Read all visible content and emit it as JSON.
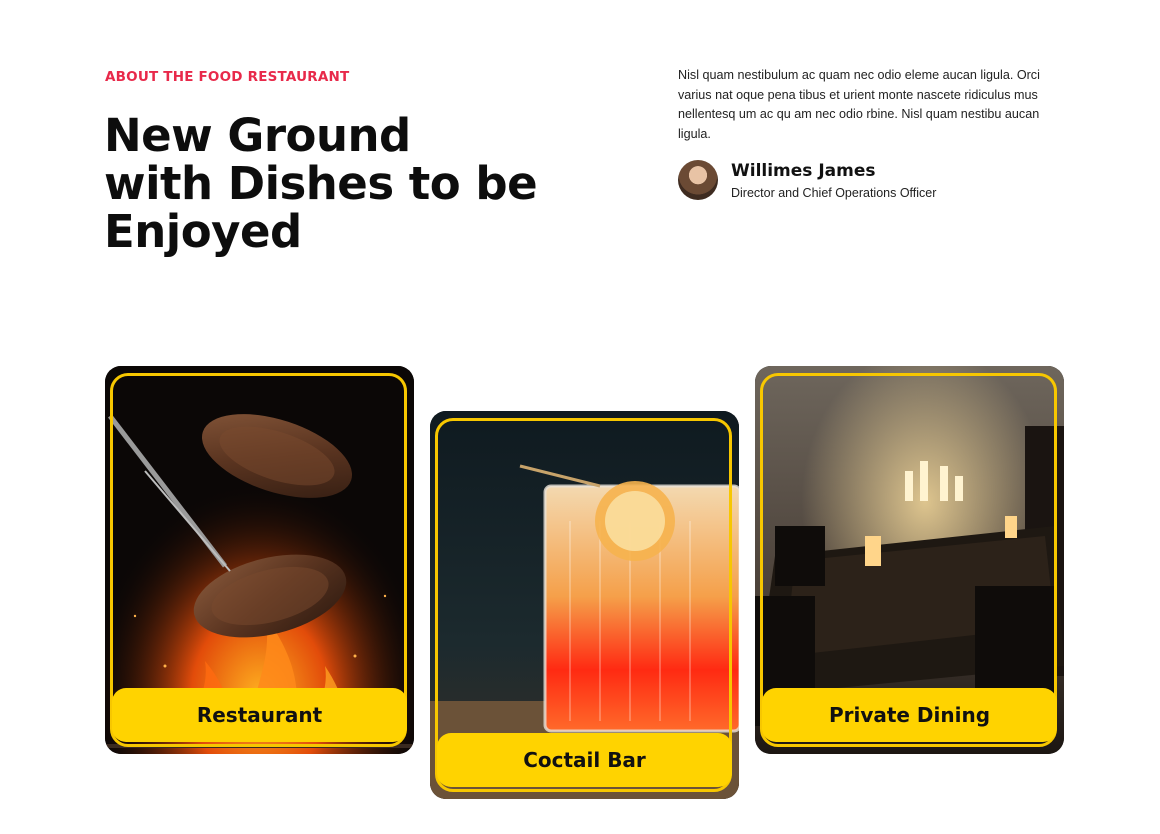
{
  "about": {
    "eyebrow": "ABOUT THE FOOD RESTAURANT",
    "headline_lines": [
      "New Ground",
      "with Dishes to be",
      "Enjoyed"
    ],
    "intro": "Nisl quam nestibulum ac quam nec odio eleme aucan ligula. Orci varius nat oque pena tibus et urient monte nascete ridiculus mus nellentesq um ac qu am nec odio rbine. Nisl quam nestibu aucan ligula."
  },
  "author": {
    "name": "Willimes James",
    "role": "Director and Chief Operations Officer"
  },
  "cards": [
    {
      "label": "Restaurant",
      "image": "grilled-steak-photo"
    },
    {
      "label": "Coctail Bar",
      "image": "cocktail-glass-photo"
    },
    {
      "label": "Private Dining",
      "image": "private-dining-room-photo"
    }
  ],
  "colors": {
    "accent": "#e8294a",
    "card_yellow": "#ffd300",
    "frame_yellow": "#f7c700",
    "text_dark": "#0d0d0d"
  }
}
